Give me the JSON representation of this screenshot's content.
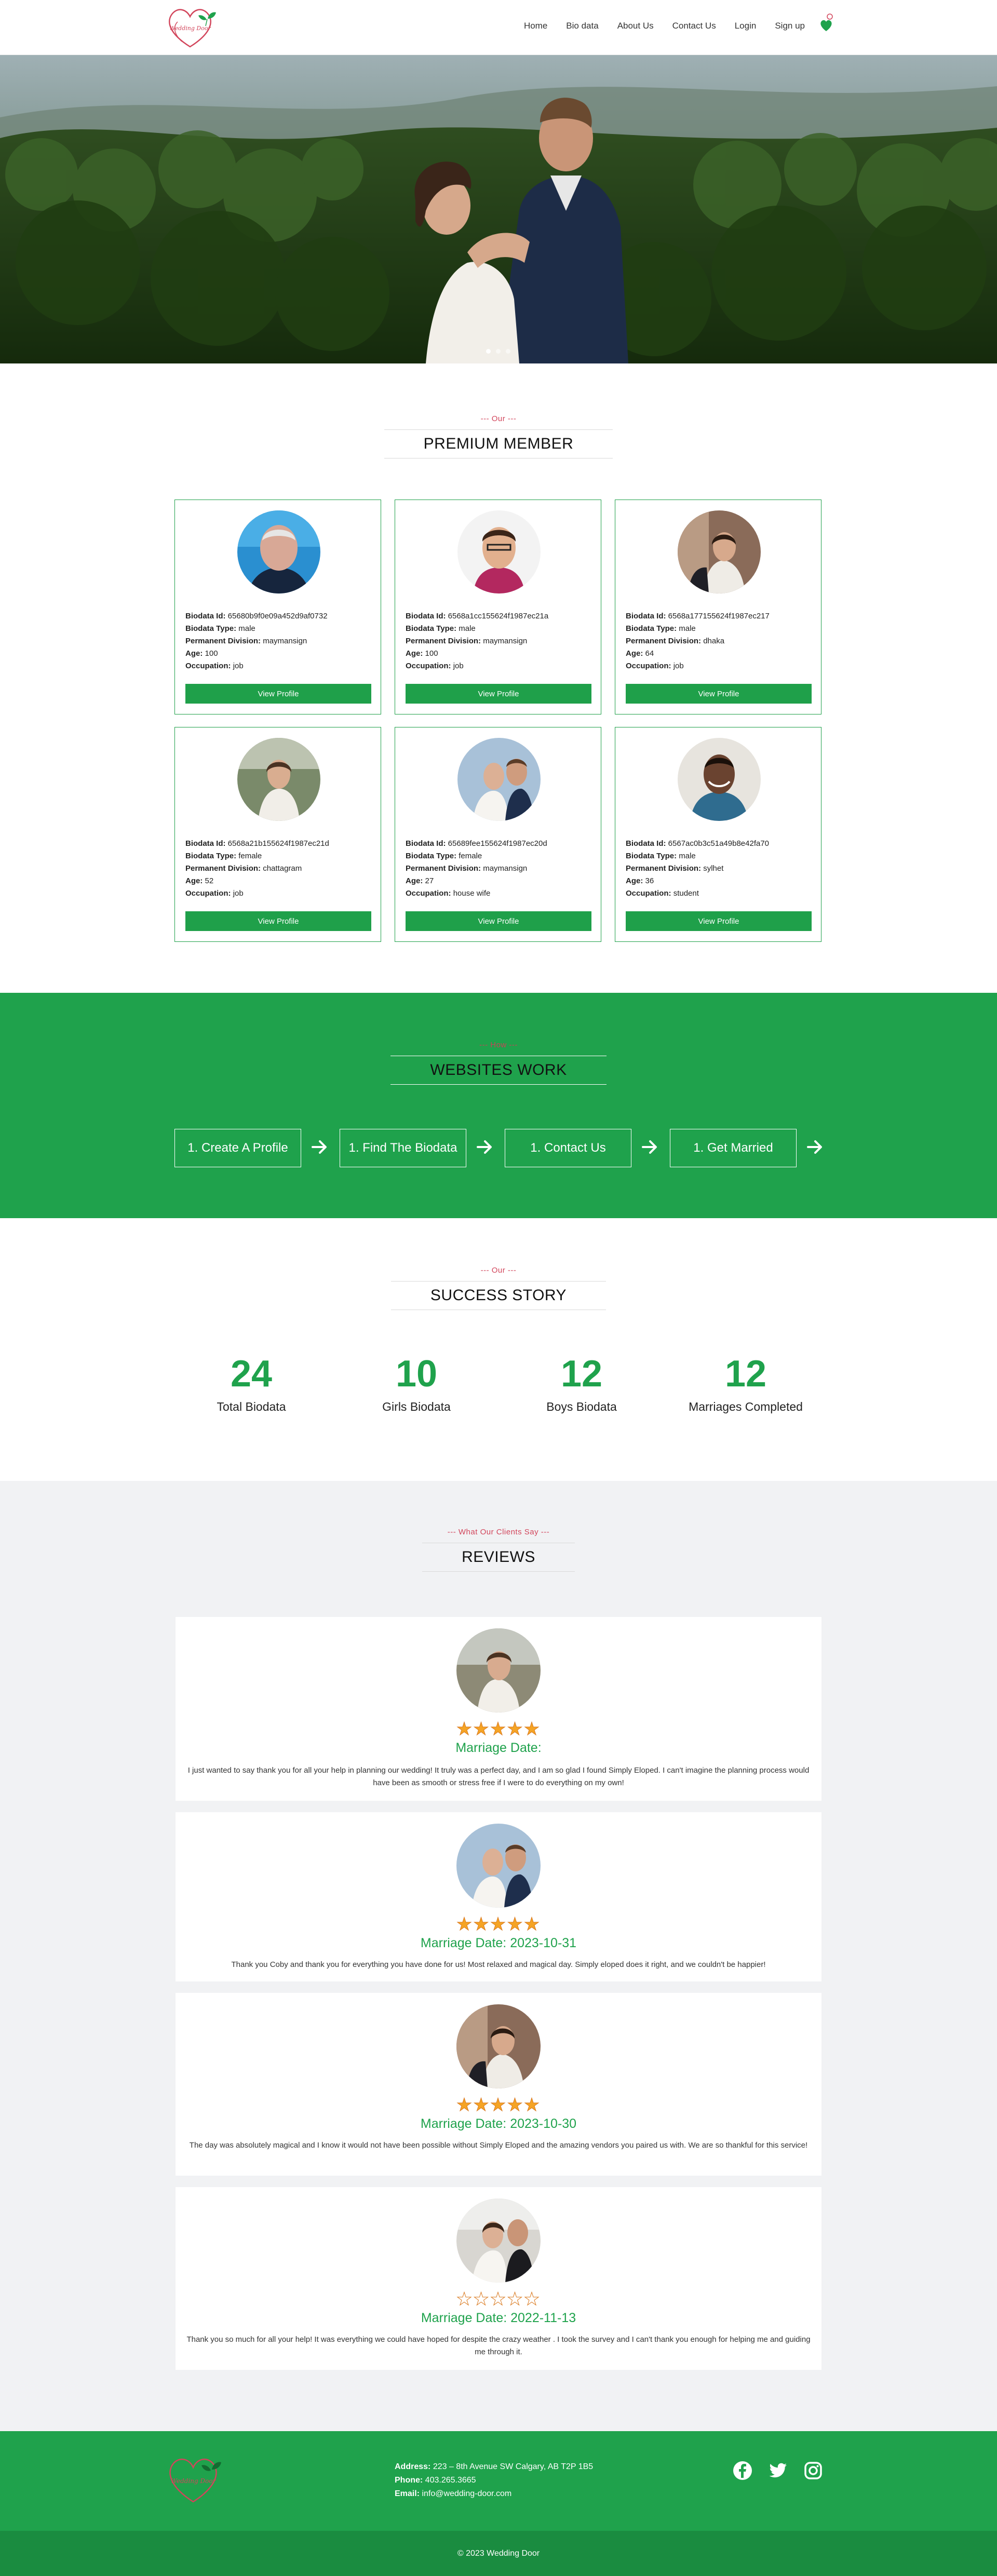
{
  "nav": {
    "links": [
      "Home",
      "Bio data",
      "About Us",
      "Contact Us",
      "Login",
      "Sign up"
    ]
  },
  "hero": {
    "dots": 3,
    "active_dot": 1
  },
  "premium": {
    "sub": "--- Our ---",
    "title": "PREMIUM MEMBER",
    "button_label": "View Profile",
    "labels": {
      "id": "Biodata Id:",
      "type": "Biodata Type:",
      "division": "Permanent Division:",
      "age": "Age:",
      "occupation": "Occupation:"
    },
    "members": [
      {
        "id": "65680b9f0e09a452d9af0732",
        "type": "male",
        "division": "maymansign",
        "age": "100",
        "occupation": "job"
      },
      {
        "id": "6568a1cc155624f1987ec21a",
        "type": "male",
        "division": "maymansign",
        "age": "100",
        "occupation": "job"
      },
      {
        "id": "6568a177155624f1987ec217",
        "type": "male",
        "division": "dhaka",
        "age": "64",
        "occupation": "job"
      },
      {
        "id": "6568a21b155624f1987ec21d",
        "type": "female",
        "division": "chattagram",
        "age": "52",
        "occupation": "job"
      },
      {
        "id": "65689fee155624f1987ec20d",
        "type": "female",
        "division": "maymansign",
        "age": "27",
        "occupation": "house wife"
      },
      {
        "id": "6567ac0b3c51a49b8e42fa70",
        "type": "male",
        "division": "sylhet",
        "age": "36",
        "occupation": "student"
      }
    ]
  },
  "work": {
    "sub": "--- How ---",
    "title": "WEBSITES WORK",
    "steps": [
      "1. Create A Profile",
      "1. Find The Biodata",
      "1. Contact Us",
      "1. Get Married"
    ]
  },
  "success": {
    "sub": "--- Our ---",
    "title": "SUCCESS STORY",
    "stats": [
      {
        "num": "24",
        "label": "Total Biodata"
      },
      {
        "num": "10",
        "label": "Girls Biodata"
      },
      {
        "num": "12",
        "label": "Boys Biodata"
      },
      {
        "num": "12",
        "label": "Marriages Completed"
      }
    ]
  },
  "reviews": {
    "sub": "--- What Our Clients Say ---",
    "title": "REVIEWS",
    "items": [
      {
        "rating": 5,
        "date": "Marriage Date:",
        "text": "I just wanted to say thank you for all your help in planning our wedding! It truly was a perfect day, and I am so glad I found Simply Eloped. I can't imagine the planning process would have been as smooth or stress free if I were to do everything on my own!"
      },
      {
        "rating": 5,
        "date": "Marriage Date: 2023-10-31",
        "text": "Thank you Coby and thank you for everything you have done for us! Most relaxed and magical day. Simply eloped does it right, and we couldn't be happier!"
      },
      {
        "rating": 5,
        "date": "Marriage Date: 2023-10-30",
        "text": "The day was absolutely magical and I know it would not have been possible without Simply Eloped and the amazing vendors you paired us with. We are so thankful for this service!"
      },
      {
        "rating": 0,
        "date": "Marriage Date: 2022-11-13",
        "text": "Thank you so much for all your help! It was everything we could have hoped for despite the crazy weather . I took the survey and I can't thank you enough for helping me and guiding me through it."
      }
    ]
  },
  "footer": {
    "address_label": "Address:",
    "address": "223 – 8th Avenue SW Calgary, AB T2P 1B5",
    "phone_label": "Phone:",
    "phone": "403.265.3665",
    "email_label": "Email:",
    "email": "info@wedding-door.com",
    "copyright": "© 2023 Wedding Door"
  },
  "colors": {
    "brand_green": "#1fa24c",
    "accent_red": "#d2455b",
    "star": "#f5a425"
  },
  "icons": [
    "heart-logo-icon",
    "heart-icon",
    "arrow-right-icon",
    "facebook-icon",
    "twitter-icon",
    "instagram-icon",
    "star-icon"
  ]
}
